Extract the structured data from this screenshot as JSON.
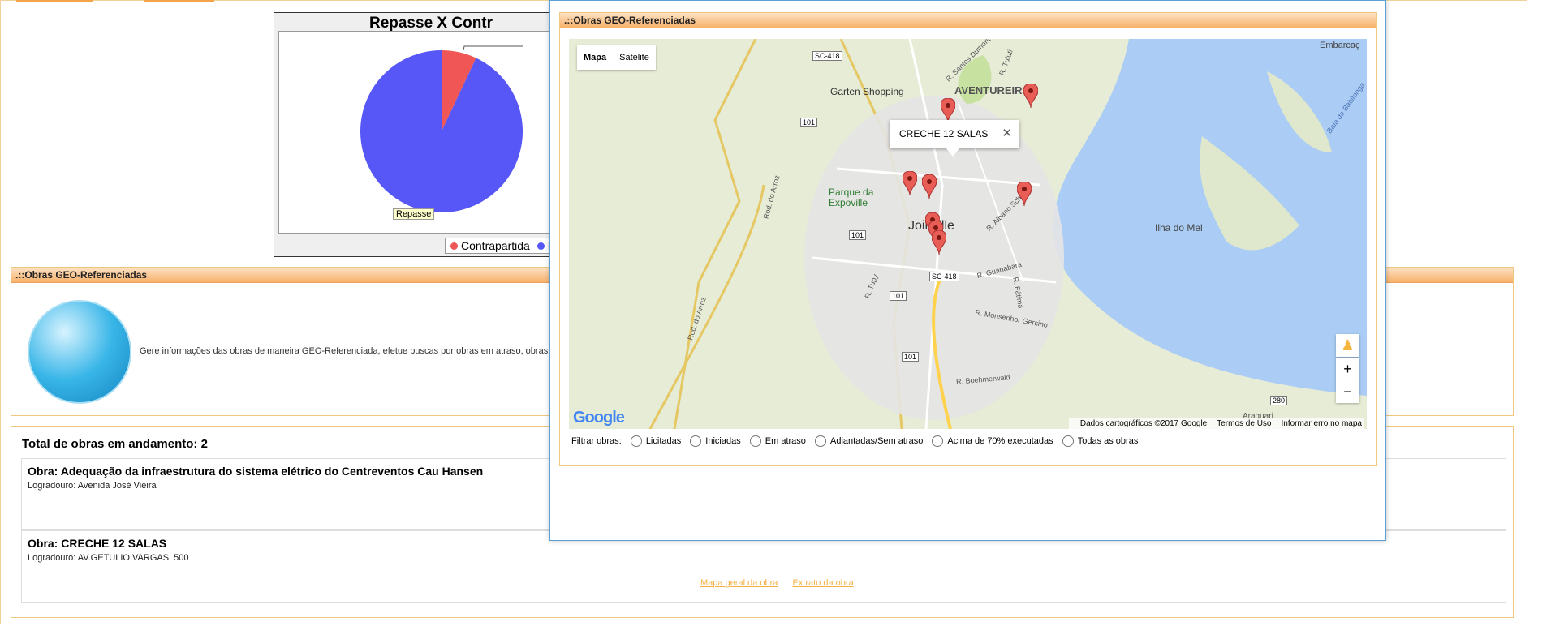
{
  "chart_data": {
    "type": "pie",
    "title": "Repasse X Contr",
    "categories": [
      "Contrapartida",
      "Repasse"
    ],
    "values": [
      7,
      93
    ],
    "slice_labels": [
      "Repasse"
    ],
    "legend_texts": [
      "Contrapartida",
      "R"
    ],
    "colors": [
      "#f05656",
      "#5657f6"
    ],
    "legend_placement": "bottom"
  },
  "main_panel": {
    "title": ".::Obras GEO-Referenciadas",
    "description": "Gere informações das obras de maneira GEO-Referenciada, efetue buscas por obras em atraso, obras"
  },
  "works": {
    "total": "Total de obras em andamento: 2",
    "items": [
      {
        "name": "Obra: Adequação da infraestrutura do sistema elétrico do Centreventos Cau Hansen",
        "address": "Logradouro: Avenida José Vieira"
      },
      {
        "name": "Obra: CRECHE 12 SALAS",
        "address": "Logradouro: AV.GETULIO VARGAS, 500"
      }
    ],
    "links": [
      "Mapa geral da obra",
      "Extrato da obra"
    ]
  },
  "modal": {
    "title": ".::Obras GEO-Referenciadas",
    "map_types": [
      "Mapa",
      "Satélite"
    ],
    "info_window": "CRECHE 12 SALAS",
    "google_logo": "Google",
    "attribution": [
      "Dados cartográficos ©2017 Google",
      "Termos de Uso",
      "Informar erro no mapa"
    ],
    "filter_label": "Filtrar obras:",
    "filter_options": [
      "Licitadas",
      "Iniciadas",
      "Em atraso",
      "Adiantadas/Sem atraso",
      "Acima de 70% executadas",
      "Todas as obras"
    ],
    "places": [
      "Garten Shopping",
      "AVENTUREIRO",
      "Parque da Expoville",
      "Joinville",
      "Ilha do Mel",
      "Embarcaç"
    ],
    "roads": [
      "SC-418",
      "101",
      "Rod. do Arroz",
      "R. Tupy",
      "R. Guanabara",
      "R. Monsenhor Gercino",
      "R. Boehmerwald",
      "280",
      "Araquari",
      "Baía da Babitonga",
      "R. Santos Dumont",
      "R. Tuiuti",
      "R. Albano Schmidt",
      "R. Fátima"
    ]
  },
  "icons": {
    "globe": "globe-icon",
    "map_marker": "map-marker-icon",
    "zoom_in": "zoom-in-icon",
    "zoom_out": "zoom-out-icon",
    "pegman": "street-view-icon"
  }
}
